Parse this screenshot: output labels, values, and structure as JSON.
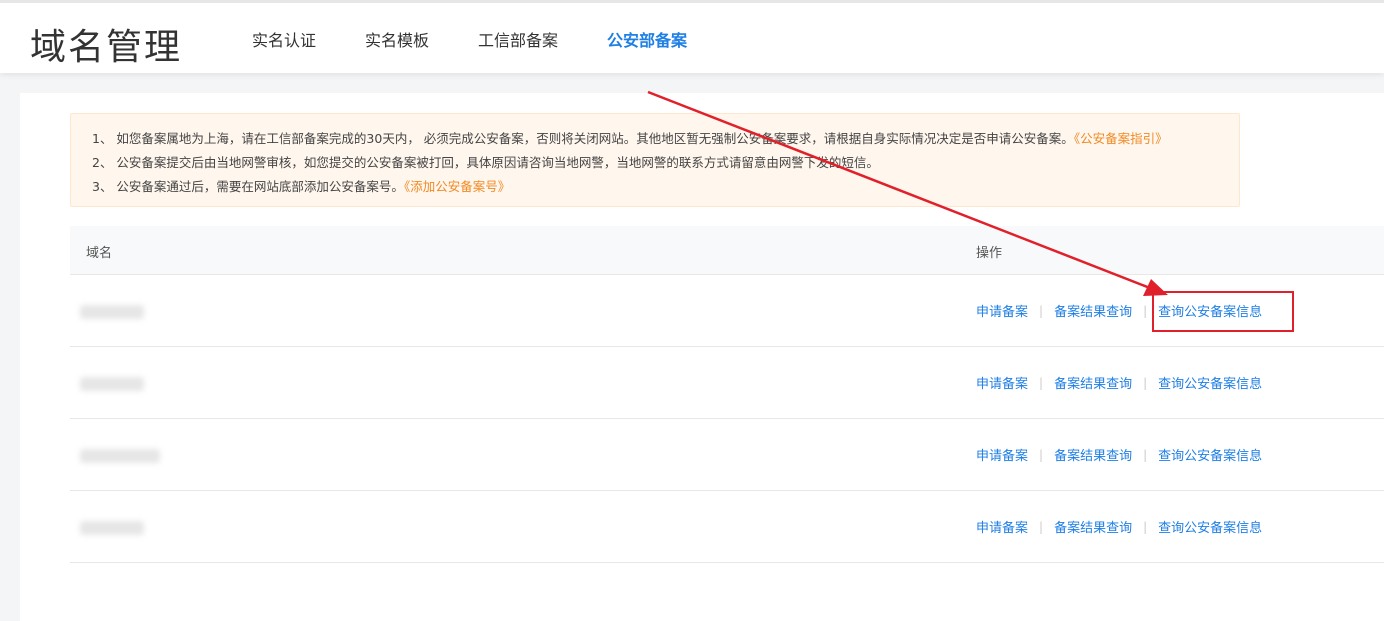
{
  "header": {
    "title": "域名管理",
    "tabs": [
      {
        "label": "实名认证",
        "active": false
      },
      {
        "label": "实名模板",
        "active": false
      },
      {
        "label": "工信部备案",
        "active": false
      },
      {
        "label": "公安部备案",
        "active": true
      }
    ]
  },
  "notice": {
    "line1_text": "1、 如您备案属地为上海，请在工信部备案完成的30天内， 必须完成公安备案，否则将关闭网站。其他地区暂无强制公安备案要求，请根据自身实际情况决定是否申请公安备案。",
    "line1_link": "《公安备案指引》",
    "line2_text": "2、 公安备案提交后由当地网警审核，如您提交的公安备案被打回，具体原因请咨询当地网警，当地网警的联系方式请留意由网警下发的短信。",
    "line3_text": "3、 公安备案通过后，需要在网站底部添加公安备案号。",
    "line3_link": "《添加公安备案号》"
  },
  "table": {
    "columns": {
      "domain": "域名",
      "ops": "操作"
    },
    "row_count": 4,
    "actions": {
      "apply": "申请备案",
      "result": "备案结果查询",
      "info": "查询公安备案信息"
    }
  },
  "colors": {
    "accent": "#1f7fe5",
    "warning_link": "#f08a24",
    "notice_bg": "#fff6ed",
    "annotation_red": "#e0202a"
  }
}
